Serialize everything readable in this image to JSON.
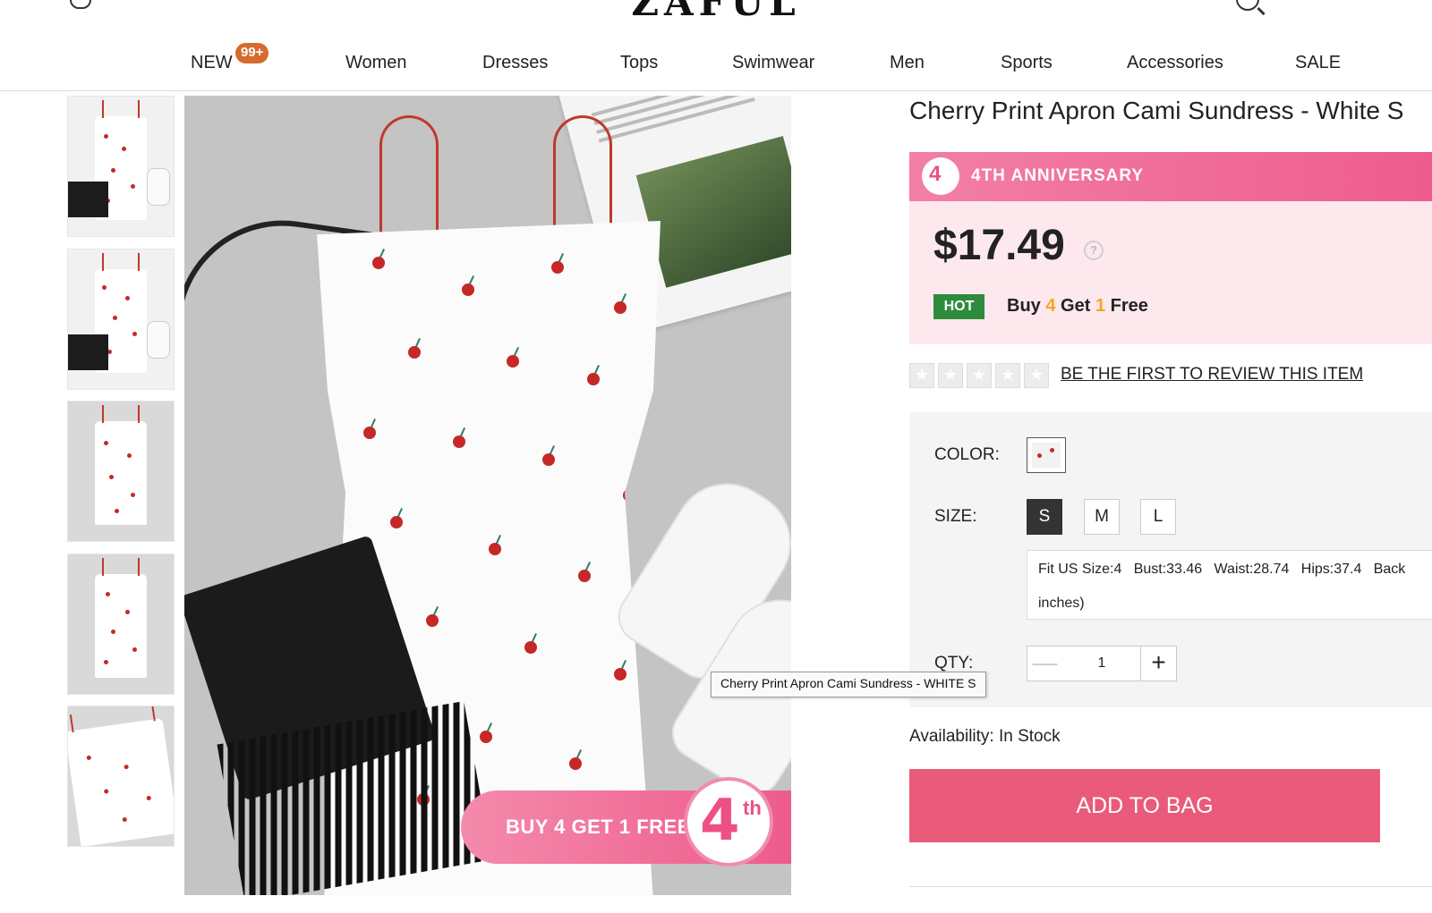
{
  "header": {
    "logo": "ZAFUL"
  },
  "nav": {
    "items": [
      "NEW",
      "Women",
      "Dresses",
      "Tops",
      "Swimwear",
      "Men",
      "Sports",
      "Accessories",
      "SALE"
    ],
    "new_badge": "99+"
  },
  "gallery": {
    "thumbnail_count": 5,
    "promo_overlay": "BUY 4 GET 1 FREE",
    "promo_logo_number": "4",
    "promo_logo_suffix": "th"
  },
  "product": {
    "title": "Cherry Print Apron Cami Sundress - White S",
    "anniversary_label": "4TH ANNIVERSARY",
    "anniversary_icon_text": "4",
    "price": "$17.49",
    "help_icon_glyph": "?",
    "hot_badge": "HOT",
    "promo": {
      "buy": "Buy",
      "buy_qty": "4",
      "get": "Get",
      "get_qty": "1",
      "free": "Free"
    },
    "rating_stars": 5,
    "review_link": "BE THE FIRST TO REVIEW THIS ITEM",
    "color_label": "COLOR:",
    "size_label": "SIZE:",
    "sizes": [
      "S",
      "M",
      "L"
    ],
    "selected_size": "S",
    "size_info_line1": "Fit US Size:4   Bust:33.46   Waist:28.74   Hips:37.4   Back",
    "size_info_line2": "inches)",
    "qty_label": "QTY:",
    "qty_value": "1",
    "qty_minus": "—",
    "qty_plus": "+",
    "availability": "Availability: In Stock",
    "add_to_bag": "ADD TO BAG"
  },
  "tooltip": "Cherry Print Apron Cami Sundress - WHITE S",
  "colors": {
    "accent_pink": "#ea5a7b",
    "price_box_bg": "#fde8ee",
    "hot_green": "#2e8b3c",
    "badge_orange": "#d56b2e",
    "promo_number_orange": "#f5a623"
  }
}
